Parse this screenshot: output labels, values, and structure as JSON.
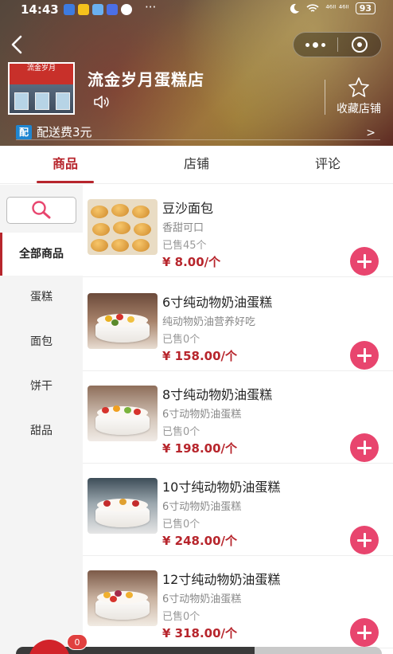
{
  "status_bar": {
    "time": "14:43",
    "more": "···",
    "network": "⁴⁶ᴵᴵ ⁴⁶ᴵᴵ",
    "battery": "93"
  },
  "store": {
    "name": "流金岁月蛋糕店",
    "logo_sign": "流金岁月",
    "favorite_label": "收藏店铺",
    "delivery_badge": "配",
    "delivery_text": "配送费3元",
    "delivery_arrow": ">"
  },
  "tabs": [
    {
      "label": "商品",
      "active": true
    },
    {
      "label": "店铺",
      "active": false
    },
    {
      "label": "评论",
      "active": false
    }
  ],
  "categories": [
    {
      "label": "全部商品",
      "active": true
    },
    {
      "label": "蛋糕",
      "active": false
    },
    {
      "label": "面包",
      "active": false
    },
    {
      "label": "饼干",
      "active": false
    },
    {
      "label": "甜品",
      "active": false
    }
  ],
  "products": [
    {
      "name": "豆沙面包",
      "desc": "香甜可口",
      "sold": "已售45个",
      "price": "¥ 8.00/个",
      "image": "bread"
    },
    {
      "name": "6寸纯动物奶油蛋糕",
      "desc": "纯动物奶油营养好吃",
      "sold": "已售0个",
      "price": "¥ 158.00/个",
      "image": "cake"
    },
    {
      "name": "8寸纯动物奶油蛋糕",
      "desc": "6寸动物奶油蛋糕",
      "sold": "已售0个",
      "price": "¥ 198.00/个",
      "image": "cake"
    },
    {
      "name": "10寸纯动物奶油蛋糕",
      "desc": "6寸动物奶油蛋糕",
      "sold": "已售0个",
      "price": "¥ 248.00/个",
      "image": "cake"
    },
    {
      "name": "12寸纯动物奶油蛋糕",
      "desc": "6寸动物奶油蛋糕",
      "sold": "已售0个",
      "price": "¥ 318.00/个",
      "image": "cake"
    }
  ],
  "cart": {
    "count": "0"
  },
  "colors": {
    "accent": "#b7252c",
    "add_button": "#e8456e",
    "delivery_badge": "#1f86d1"
  },
  "icons": {
    "back": "chevron-left-icon",
    "more": "more-dots-icon",
    "close": "target-close-icon",
    "speaker": "speaker-icon",
    "favorite": "star-outline-icon",
    "search": "search-icon",
    "add": "plus-circle-icon"
  }
}
